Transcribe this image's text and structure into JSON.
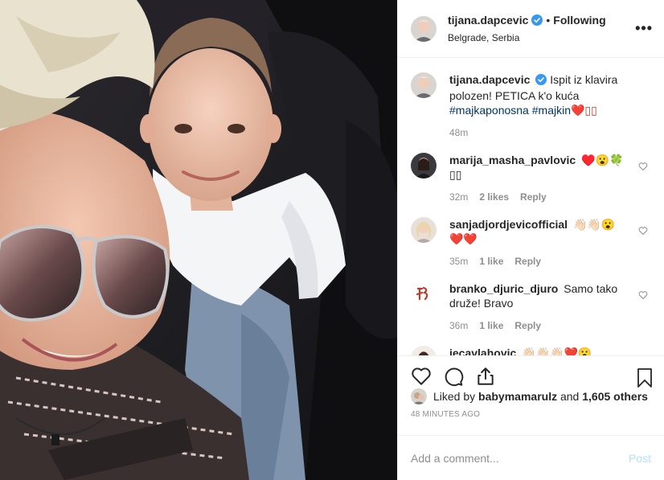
{
  "post": {
    "author": "tijana.dapcevic",
    "following_label": "Following",
    "location": "Belgrade, Serbia",
    "more_label": "•••"
  },
  "caption": {
    "author": "tijana.dapcevic",
    "text": "Ispit iz klavira polozen! PETICA k'o kuća",
    "hashtag1": "#majkaponosna",
    "hashtag2": "#majkin",
    "emoji": "❤️▯▯",
    "time": "48m"
  },
  "comments": [
    {
      "user": "marija_masha_pavlovic",
      "text": "♥️😮🍀▯▯",
      "time": "32m",
      "likes": "2 likes",
      "reply": "Reply"
    },
    {
      "user": "sanjadjordjevicofficial",
      "text": "👋🏻👋🏻😮❤️❤️",
      "time": "35m",
      "likes": "1 like",
      "reply": "Reply"
    },
    {
      "user": "branko_djuric_djuro",
      "text": "Samo tako druže! Bravo",
      "time": "36m",
      "likes": "1 like",
      "reply": "Reply"
    },
    {
      "user": "jecavlahovic",
      "text": "👋🏻👋🏻👋🏻❤️😮",
      "time": "",
      "likes": "",
      "reply": ""
    }
  ],
  "likes": {
    "prefix": "Liked by",
    "user": "babymamarulz",
    "and": "and",
    "others": "1,605 others"
  },
  "timestamp": "48 MINUTES AGO",
  "comment_box": {
    "placeholder": "Add a comment...",
    "post_label": "Post"
  },
  "colors": {
    "verified_blue": "#3897f0",
    "link_blue": "#003569",
    "post_disabled": "#b2dffc",
    "muted": "#8e8e8e"
  }
}
